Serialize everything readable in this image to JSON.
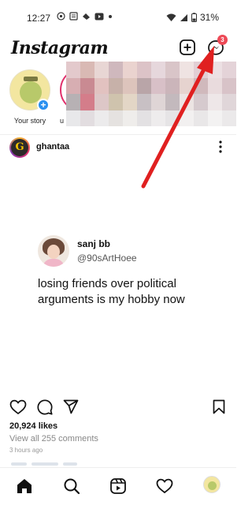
{
  "status_bar": {
    "time": "12:27",
    "battery": "31%"
  },
  "header": {
    "logo": "Instagram",
    "dm_badge_count": "3"
  },
  "stories": {
    "my_story_label": "Your story",
    "other_story_label": "u"
  },
  "post": {
    "username": "ghantaa",
    "tweet": {
      "name": "sanj bb",
      "handle": "@90sArtHoee",
      "text": "losing friends over political arguments is my hobby now"
    },
    "likes": "20,924 likes",
    "comments": "View all 255 comments",
    "posted": "3 hours ago"
  },
  "nav": {
    "items": [
      "home-icon",
      "search-icon",
      "reels-icon",
      "heart-icon",
      "profile-avatar"
    ]
  },
  "colors": {
    "badge": "#ed4956",
    "story_plus": "#2a90f0",
    "annotation_arrow": "#e02020"
  }
}
